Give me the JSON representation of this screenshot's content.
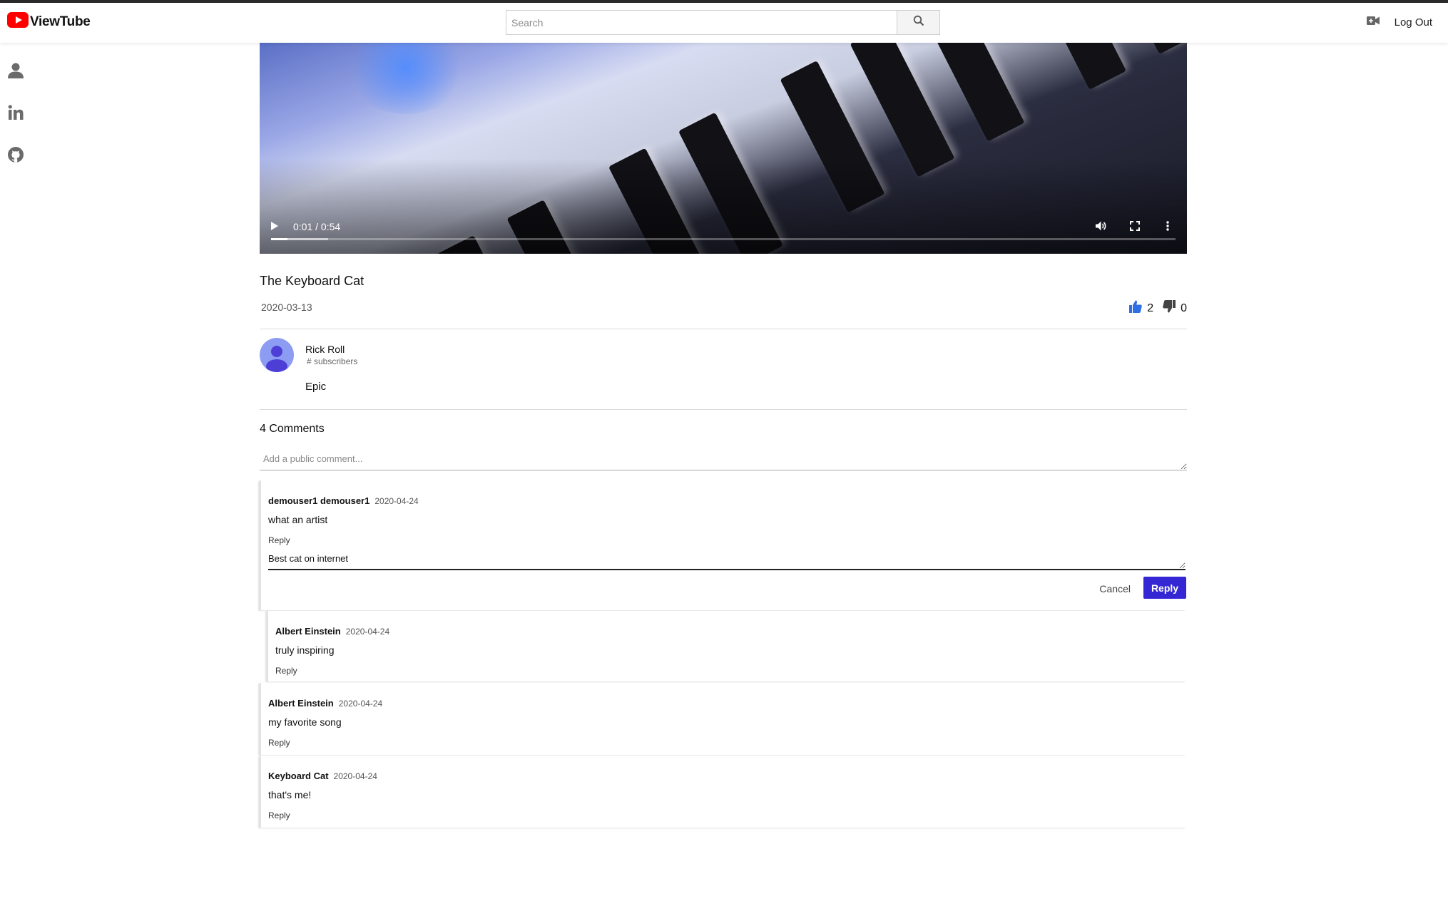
{
  "app": {
    "name": "ViewTube",
    "brand_color": "#ff0000"
  },
  "header": {
    "search_placeholder": "Search",
    "search_icon": "search-icon",
    "upload_icon": "video-camera-icon",
    "logout_label": "Log Out"
  },
  "sidebar": {
    "items": [
      {
        "icon": "person-icon"
      },
      {
        "icon": "linkedin-icon"
      },
      {
        "icon": "github-icon"
      }
    ]
  },
  "video": {
    "time": "0:01 / 0:54",
    "progress_fraction": 0.0185,
    "buffered_fraction": 0.063,
    "title": "The Keyboard Cat",
    "date": "2020-03-13",
    "likes": "2",
    "dislikes": "0",
    "like_color": "#2f6fe6",
    "dislike_color": "#444444"
  },
  "channel": {
    "name": "Rick Roll",
    "subscribers": "# subscribers",
    "description": "Epic",
    "avatar_color": "#8d9cf3"
  },
  "comments": {
    "count_label": "4 Comments",
    "add_placeholder": "Add a public comment...",
    "reply_label": "Reply",
    "cancel_label": "Cancel",
    "reply_button_color": "#3527d3",
    "items": [
      {
        "author": "demouser1 demouser1",
        "date": "2020-04-24",
        "text": "what an artist",
        "reply_draft": "Best cat on internet"
      },
      {
        "author": "Albert Einstein",
        "date": "2020-04-24",
        "text": "truly inspiring"
      },
      {
        "author": "Albert Einstein",
        "date": "2020-04-24",
        "text": "my favorite song"
      },
      {
        "author": "Keyboard Cat",
        "date": "2020-04-24",
        "text": "that's me!"
      }
    ]
  }
}
